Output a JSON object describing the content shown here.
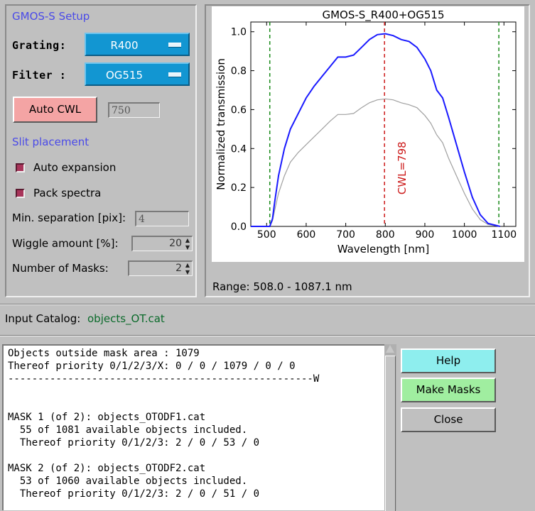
{
  "setup": {
    "title": "GMOS-S Setup",
    "grating_label": "Grating:",
    "grating_value": "R400",
    "filter_label": "Filter :",
    "filter_value": "OG515",
    "auto_cwl_label": "Auto CWL",
    "cwl_value": "750",
    "slit_title": "Slit placement",
    "auto_expansion_label": "Auto expansion",
    "pack_spectra_label": "Pack spectra",
    "min_sep_label": "Min. separation [pix]:",
    "min_sep_value": "4",
    "wiggle_label": "Wiggle amount [%]:",
    "wiggle_value": "20",
    "num_masks_label": "Number of Masks:",
    "num_masks_value": "2",
    "colors": {
      "dropdown": "#1296d2",
      "auto_cwl_button": "#f4a4a4",
      "checkbox": "#a8345a",
      "section_title": "#4a4ae8"
    }
  },
  "plot": {
    "range_text": "Range: 508.0 - 1087.1 nm"
  },
  "chart_data": {
    "type": "line",
    "title": "GMOS-S_R400+OG515",
    "xlabel": "Wavelength [nm]",
    "ylabel": "Normalized transmission",
    "xlim": [
      460,
      1130
    ],
    "ylim": [
      0,
      1.05
    ],
    "x_ticks": [
      500,
      600,
      700,
      800,
      900,
      1000,
      1100
    ],
    "y_ticks": [
      0.0,
      0.2,
      0.4,
      0.6,
      0.8,
      1.0
    ],
    "x_tick_labels": [
      "500",
      "600",
      "700",
      "800",
      "900",
      "1000",
      "1100"
    ],
    "y_tick_labels": [
      "0.0",
      "0.2",
      "0.4",
      "0.6",
      "0.8",
      "1.0"
    ],
    "series": [
      {
        "color": "#1a1aff",
        "x": [
          460,
          508,
          515,
          520,
          530,
          545,
          560,
          580,
          600,
          620,
          640,
          660,
          680,
          700,
          720,
          740,
          760,
          780,
          800,
          820,
          840,
          860,
          880,
          900,
          915,
          930,
          945,
          960,
          980,
          1000,
          1020,
          1040,
          1060,
          1080,
          1090
        ],
        "y": [
          0,
          0,
          0.04,
          0.12,
          0.26,
          0.4,
          0.5,
          0.58,
          0.66,
          0.72,
          0.77,
          0.82,
          0.87,
          0.87,
          0.88,
          0.92,
          0.96,
          0.985,
          0.99,
          0.98,
          0.96,
          0.95,
          0.92,
          0.86,
          0.8,
          0.7,
          0.66,
          0.56,
          0.42,
          0.28,
          0.15,
          0.06,
          0.015,
          0.005,
          0
        ]
      },
      {
        "color": "#a0a0a0",
        "x": [
          460,
          508,
          515,
          520,
          530,
          545,
          560,
          580,
          600,
          620,
          640,
          660,
          680,
          700,
          720,
          740,
          760,
          780,
          800,
          820,
          840,
          860,
          880,
          900,
          915,
          930,
          945,
          960,
          980,
          1000,
          1020,
          1040,
          1060,
          1080,
          1090
        ],
        "y": [
          0,
          0,
          0.03,
          0.08,
          0.17,
          0.26,
          0.33,
          0.38,
          0.42,
          0.46,
          0.5,
          0.54,
          0.575,
          0.575,
          0.58,
          0.61,
          0.635,
          0.65,
          0.655,
          0.65,
          0.635,
          0.625,
          0.61,
          0.57,
          0.53,
          0.47,
          0.43,
          0.35,
          0.26,
          0.17,
          0.09,
          0.035,
          0.01,
          0.003,
          0
        ]
      }
    ],
    "vlines": [
      {
        "x": 508,
        "color": "#1a8a1a",
        "style": "dashed"
      },
      {
        "x": 1087.1,
        "color": "#1a8a1a",
        "style": "dashed"
      },
      {
        "x": 798,
        "color": "#cc1a1a",
        "style": "dashed"
      }
    ],
    "annotation": "CWL=798",
    "grid": false
  },
  "catalog": {
    "label": "Input Catalog:",
    "value": "objects_OT.cat"
  },
  "log": {
    "lines": [
      "Objects outside mask area : 1079",
      "Thereof priority 0/1/2/3/X: 0 / 0 / 1079 / 0 / 0",
      "---------------------------------------------------W",
      "",
      "",
      "MASK 1 (of 2): objects_OTODF1.cat",
      "  55 of 1081 available objects included.",
      "  Thereof priority 0/1/2/3: 2 / 0 / 53 / 0",
      "",
      "MASK 2 (of 2): objects_OTODF2.cat",
      "  53 of 1060 available objects included.",
      "  Thereof priority 0/1/2/3: 2 / 0 / 51 / 0"
    ]
  },
  "actions": {
    "help": "Help",
    "make_masks": "Make Masks",
    "close": "Close",
    "colors": {
      "help": "#8eeeee",
      "make_masks": "#a0eea0",
      "close": "#c0c0c0"
    }
  }
}
